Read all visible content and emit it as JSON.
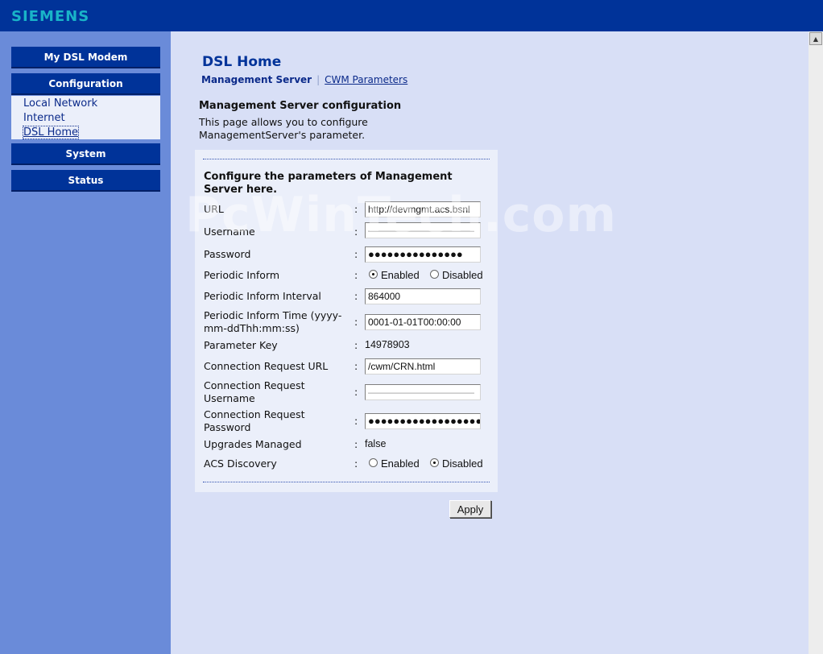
{
  "brand": "SIEMENS",
  "sidebar": {
    "items": [
      {
        "label": "My DSL Modem"
      },
      {
        "label": "Configuration"
      },
      {
        "label": "System"
      },
      {
        "label": "Status"
      }
    ],
    "config_subitems": [
      {
        "label": "Local Network"
      },
      {
        "label": "Internet"
      },
      {
        "label": "DSL Home",
        "selected": true
      }
    ]
  },
  "page": {
    "title": "DSL Home",
    "tabs": [
      {
        "label": "Management Server",
        "active": true
      },
      {
        "label": "CWM Parameters",
        "active": false
      }
    ],
    "section_title": "Management Server configuration",
    "section_desc": "This page allows you to configure ManagementServer's parameter."
  },
  "form": {
    "heading": "Configure the parameters of Management Server here.",
    "colon": ":",
    "url": {
      "label": "URL",
      "value": "http://devmgmt.acs.bsnl"
    },
    "username": {
      "label": "Username",
      "value": "———————————"
    },
    "password": {
      "label": "Password",
      "value": "●●●●●●●●●●●●●●●"
    },
    "periodic_inform": {
      "label": "Periodic Inform",
      "options": [
        "Enabled",
        "Disabled"
      ],
      "selected": "Enabled"
    },
    "periodic_inform_interval": {
      "label": "Periodic Inform Interval",
      "value": "864000"
    },
    "periodic_inform_time": {
      "label": "Periodic Inform Time (yyyy-mm-ddThh:mm:ss)",
      "value": "0001-01-01T00:00:00"
    },
    "parameter_key": {
      "label": "Parameter Key",
      "value": "14978903"
    },
    "connection_request_url": {
      "label": "Connection Request URL",
      "value": "/cwm/CRN.html"
    },
    "connection_request_username": {
      "label": "Connection Request Username",
      "value": "———————————"
    },
    "connection_request_password": {
      "label": "Connection Request Password",
      "value": "●●●●●●●●●●●●●●●●●●●"
    },
    "upgrades_managed": {
      "label": "Upgrades Managed",
      "value": "false"
    },
    "acs_discovery": {
      "label": "ACS Discovery",
      "options": [
        "Enabled",
        "Disabled"
      ],
      "selected": "Disabled"
    },
    "apply_label": "Apply"
  },
  "watermark": "PcWinTech.com",
  "colors": {
    "topbar": "#003399",
    "sidebar": "#6a8bd9",
    "main_bg": "#d8dff6",
    "logo": "#19b4c8"
  }
}
